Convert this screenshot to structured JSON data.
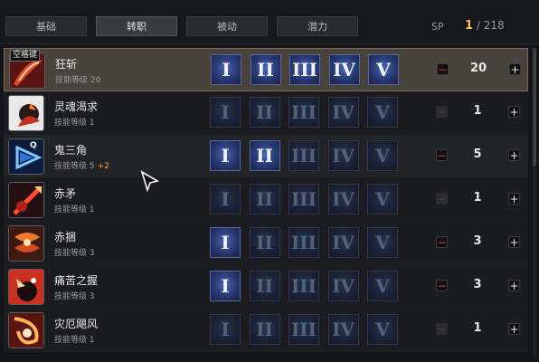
{
  "tabs": [
    {
      "label": "基础"
    },
    {
      "label": "转职"
    },
    {
      "label": "被动"
    },
    {
      "label": "潜力"
    }
  ],
  "active_tab": "转职",
  "sp": {
    "label": "SP",
    "current": "1",
    "total": "/ 218"
  },
  "skills": [
    {
      "name": "狂斩",
      "level_text": "技能等级 20",
      "bonus": "",
      "tiers_unlocked": 5,
      "level": "20",
      "key": "空格键",
      "hotkey": "",
      "icon": "slash-red",
      "state": "selected",
      "minus_enabled": true
    },
    {
      "name": "灵魂渴求",
      "level_text": "技能等级 1",
      "bonus": "",
      "tiers_unlocked": 0,
      "level": "1",
      "key": "",
      "hotkey": "",
      "icon": "soul-drain",
      "state": "",
      "minus_enabled": false
    },
    {
      "name": "鬼三角",
      "level_text": "技能等级 5",
      "bonus": "+2",
      "tiers_unlocked": 2,
      "level": "5",
      "key": "",
      "hotkey": "Q",
      "icon": "triangle-blue",
      "state": "hover",
      "minus_enabled": true
    },
    {
      "name": "赤矛",
      "level_text": "技能等级 1",
      "bonus": "",
      "tiers_unlocked": 0,
      "level": "1",
      "key": "",
      "hotkey": "",
      "icon": "red-spear",
      "state": "",
      "minus_enabled": false
    },
    {
      "name": "赤捆",
      "level_text": "技能等级 3",
      "bonus": "",
      "tiers_unlocked": 1,
      "level": "3",
      "key": "",
      "hotkey": "",
      "icon": "red-bind",
      "state": "",
      "minus_enabled": true
    },
    {
      "name": "痛苦之握",
      "level_text": "技能等级 3",
      "bonus": "",
      "tiers_unlocked": 1,
      "level": "3",
      "key": "",
      "hotkey": "",
      "icon": "pain-grip",
      "state": "",
      "minus_enabled": true
    },
    {
      "name": "灾厄飓风",
      "level_text": "技能等级 1",
      "bonus": "",
      "tiers_unlocked": 0,
      "level": "1",
      "key": "",
      "hotkey": "",
      "icon": "calamity-storm",
      "state": "",
      "minus_enabled": false
    }
  ],
  "tier_labels": [
    "I",
    "II",
    "III",
    "IV",
    "V"
  ],
  "buttons": {
    "minus": "−",
    "plus": "+"
  },
  "colors": {
    "accent_gold": "#f3c24f",
    "bonus_orange": "#f0a35c",
    "minus_red": "#e23b3b",
    "tier_active": "#2a3c78"
  }
}
